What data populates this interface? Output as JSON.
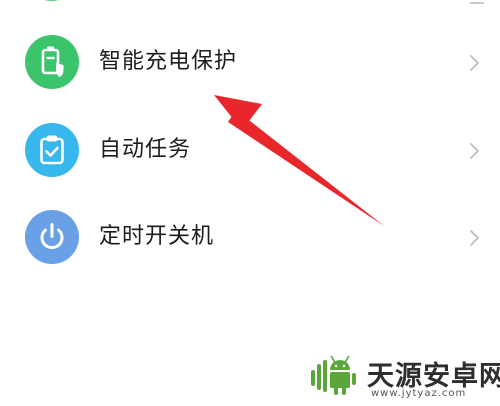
{
  "settings_list": {
    "items": [
      {
        "label": "智能充电保护",
        "icon": "battery-shield-icon",
        "color": "#3cc46d"
      },
      {
        "label": "自动任务",
        "icon": "clipboard-check-icon",
        "color": "#37b7ec"
      },
      {
        "label": "定时开关机",
        "icon": "power-icon",
        "color": "#6aa0e6"
      }
    ]
  },
  "annotation": {
    "color": "#e8262b"
  },
  "watermark": {
    "title": "天源安卓网",
    "url": "www.jytyaz.com"
  }
}
